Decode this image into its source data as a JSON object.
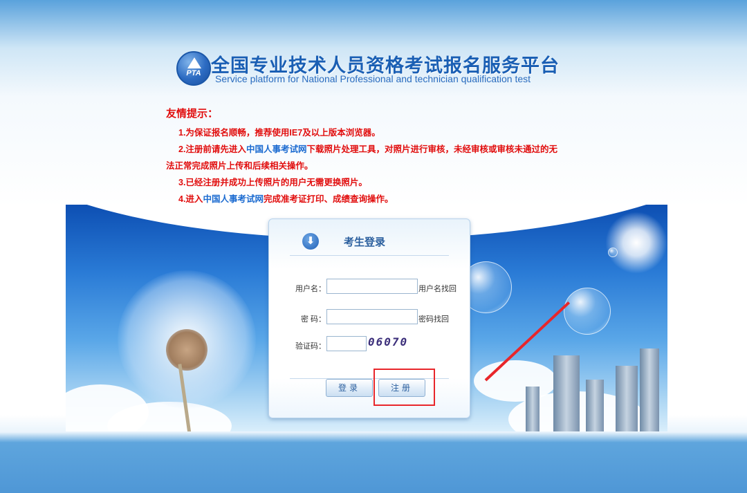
{
  "header": {
    "logo_text": "PTA",
    "title_cn": "全国专业技术人员资格考试报名服务平台",
    "title_en": "Service platform for National Professional and technician qualification test"
  },
  "notice": {
    "title": "友情提示：",
    "item1": "1.为保证报名顺畅，推荐使用IE7及以上版本浏览器。",
    "item2_pre": "2.注册前请先进入",
    "item2_link": "中国人事考试网",
    "item2_post_line1": "下载照片处理工具，对照片进行审核，未经审核或审核未通过的无",
    "item2_line2": "法正常完成照片上传和后续相关操作。",
    "item3": "3.已经注册并成功上传照片的用户无需更换照片。",
    "item4_pre": "4.进入",
    "item4_link": "中国人事考试网",
    "item4_post": "完成准考证打印、成绩查询操作。"
  },
  "login": {
    "title": "考生登录",
    "username_label": "用户名：",
    "username_value": "",
    "username_recover": "用户名找回",
    "password_label": "密  码：",
    "password_value": "",
    "password_recover": "密码找回",
    "captcha_label": "验证码：",
    "captcha_value": "",
    "captcha_image_text": "06070",
    "login_button": "登录",
    "register_button": "注册"
  },
  "colors": {
    "notice_red": "#e10d0d",
    "link_blue": "#1a6ad0",
    "title_blue": "#1a5fb4",
    "highlight_red": "#e8262a"
  }
}
